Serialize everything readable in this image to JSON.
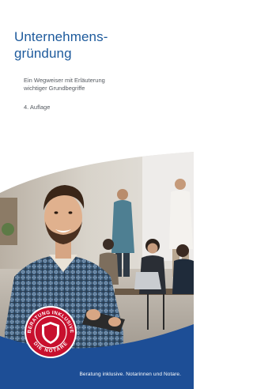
{
  "cover": {
    "title_line1": "Unternehmens-",
    "title_line2": "gründung",
    "subtitle_line1": "Ein Wegweiser mit Erläuterung",
    "subtitle_line2": "wichtiger Grundbegriffe",
    "edition": "4. Auflage"
  },
  "seal": {
    "text_top": "BERATUNG INKLUSIVE",
    "text_bottom": "DIE NOTARE",
    "color": "#c8102e"
  },
  "footer": {
    "text": "Beratung inklusive. Notarinnen und Notare.",
    "color": "#1d4e96"
  },
  "colors": {
    "accent": "#1d5a9c",
    "text": "#555a60"
  }
}
